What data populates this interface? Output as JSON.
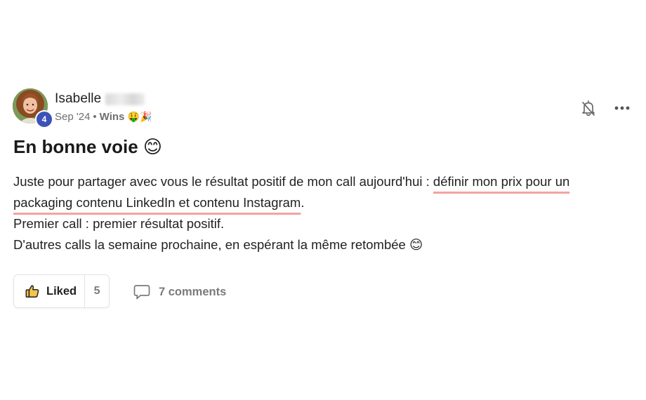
{
  "post": {
    "author": {
      "name": "Isabelle",
      "level": "4"
    },
    "meta": {
      "date": "Sep '24",
      "separator": "•",
      "space": "Wins",
      "space_emojis": "🤑🎉"
    },
    "title": "En bonne voie 😊",
    "body": {
      "line1_plain": "Juste pour partager avec vous le résultat positif de mon call aujourd'hui : ",
      "line1_highlight": "définir mon prix pour un",
      "line2_highlight": "packaging contenu LinkedIn et contenu Instagram",
      "line2_plain": ".",
      "line3": "Premier call : premier résultat positif.",
      "line4": "D'autres calls la semaine prochaine, en espérant la même retombée 😊"
    },
    "actions": {
      "like_label": "Liked",
      "like_count": "5",
      "comments_label": "7 comments"
    },
    "icons": {
      "bell": "bell-off-icon",
      "more": "more-dots-icon",
      "like": "thumbs-up-icon",
      "comment": "comment-bubble-icon"
    },
    "colors": {
      "highlight_underline": "#f2a3a3",
      "level_badge": "#3d52b8",
      "muted_text": "#7a7a7a"
    }
  }
}
